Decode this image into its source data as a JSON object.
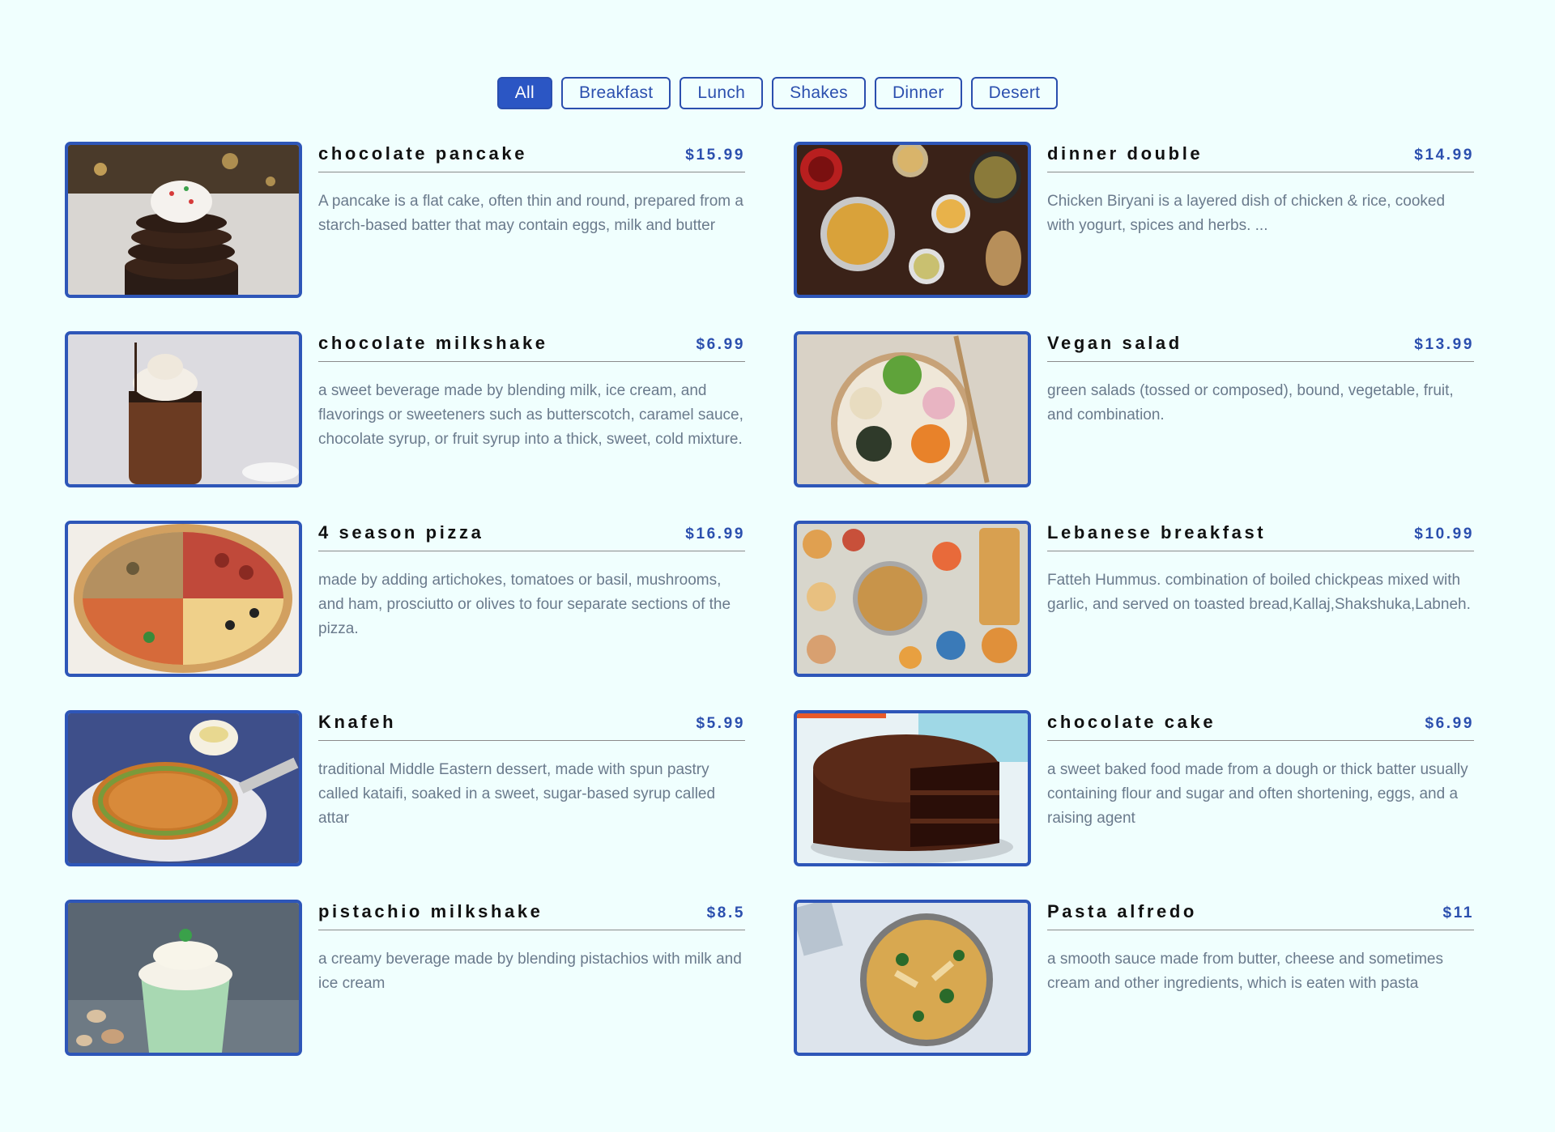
{
  "filters": [
    {
      "label": "All",
      "active": true
    },
    {
      "label": "Breakfast",
      "active": false
    },
    {
      "label": "Lunch",
      "active": false
    },
    {
      "label": "Shakes",
      "active": false
    },
    {
      "label": "Dinner",
      "active": false
    },
    {
      "label": "Desert",
      "active": false
    }
  ],
  "menu": {
    "items": [
      {
        "name": "chocolate pancake",
        "price": "$15.99",
        "description": "A pancake is a flat cake, often thin and round, prepared from a starch-based batter that may contain eggs, milk and butter",
        "image_icon": "chocolate-pancake-photo"
      },
      {
        "name": "dinner double",
        "price": "$14.99",
        "description": "Chicken Biryani is a layered dish of chicken & rice, cooked with yogurt, spices and herbs. ...",
        "image_icon": "dinner-spread-photo"
      },
      {
        "name": "chocolate milkshake",
        "price": "$6.99",
        "description": "a sweet beverage made by blending milk, ice cream, and flavorings or sweeteners such as butterscotch, caramel sauce, chocolate syrup, or fruit syrup into a thick, sweet, cold mixture.",
        "image_icon": "chocolate-milkshake-photo"
      },
      {
        "name": "Vegan salad",
        "price": "$13.99",
        "description": "green salads (tossed or composed), bound, vegetable, fruit, and combination.",
        "image_icon": "vegan-salad-photo"
      },
      {
        "name": "4 season pizza",
        "price": "$16.99",
        "description": "made by adding artichokes, tomatoes or basil, mushrooms, and ham, prosciutto or olives to four separate sections of the pizza.",
        "image_icon": "pizza-photo"
      },
      {
        "name": "Lebanese breakfast",
        "price": "$10.99",
        "description": "Fatteh Hummus. combination of boiled chickpeas mixed with garlic, and served on toasted bread,Kallaj,Shakshuka,Labneh.",
        "image_icon": "lebanese-breakfast-photo"
      },
      {
        "name": "Knafeh",
        "price": "$5.99",
        "description": "traditional Middle Eastern dessert, made with spun pastry called kataifi, soaked in a sweet, sugar-based syrup called attar",
        "image_icon": "knafeh-photo"
      },
      {
        "name": "chocolate cake",
        "price": "$6.99",
        "description": "a sweet baked food made from a dough or thick batter usually containing flour and sugar and often shortening, eggs, and a raising agent",
        "image_icon": "chocolate-cake-photo"
      },
      {
        "name": "pistachio milkshake",
        "price": "$8.5",
        "description": "a creamy beverage made by blending pistachios with milk and ice cream",
        "image_icon": "pistachio-milkshake-photo"
      },
      {
        "name": "Pasta alfredo",
        "price": "$11",
        "description": "a smooth sauce made from butter, cheese and sometimes cream and other ingredients, which is eaten with pasta",
        "image_icon": "pasta-alfredo-photo"
      }
    ]
  },
  "colors": {
    "background": "#f0fffe",
    "accent": "#2b56c4",
    "price": "#2b4fae",
    "description": "#6a7a8c"
  }
}
